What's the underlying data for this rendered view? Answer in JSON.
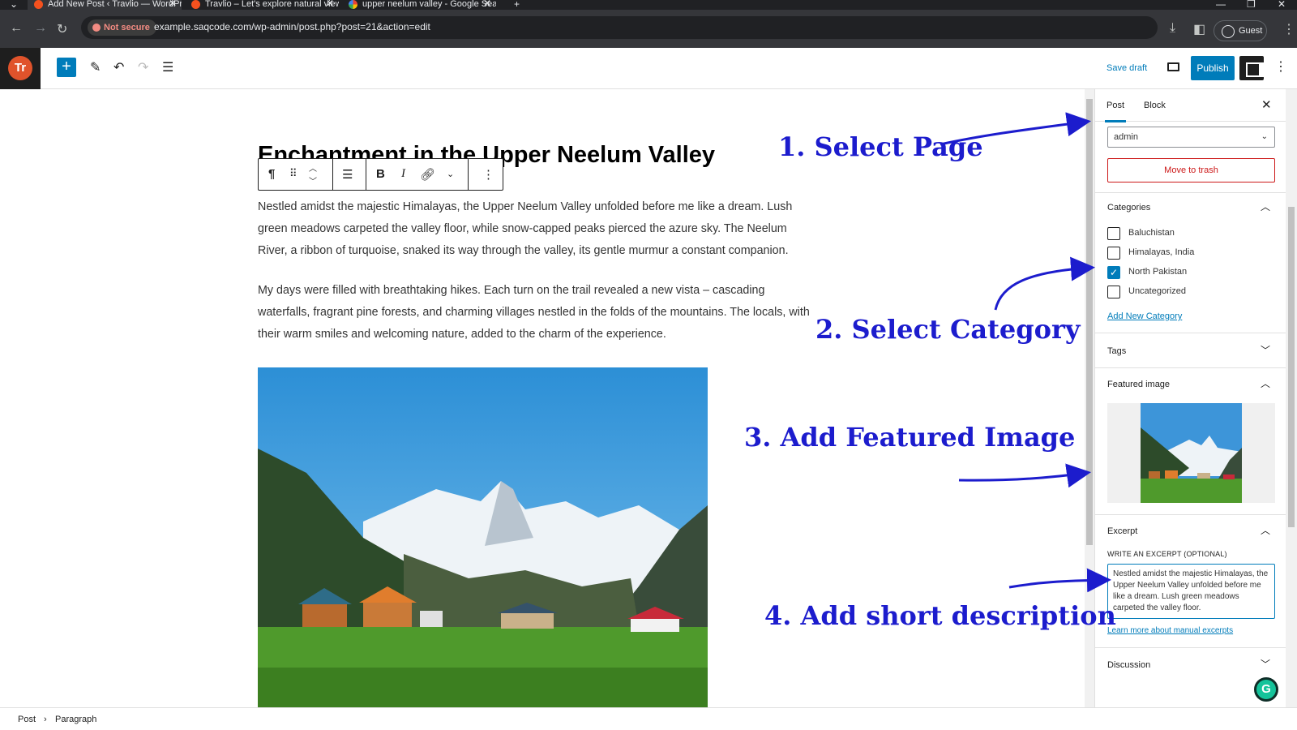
{
  "browser": {
    "tabs": [
      {
        "label": "Add New Post ‹ Travlio — WordPress"
      },
      {
        "label": "Travlio – Let's explore natural views"
      },
      {
        "label": "upper neelum valley - Google Search"
      }
    ],
    "not_secure_label": "Not secure",
    "url": "example.saqcode.com/wp-admin/post.php?post=21&action=edit",
    "guest_label": "Guest"
  },
  "wp_header": {
    "logo_text": "Tr",
    "save_draft_label": "Save draft",
    "publish_label": "Publish"
  },
  "post": {
    "title": "Enchantment in the Upper Neelum Valley",
    "paragraphs": [
      "Nestled amidst the majestic Himalayas, the Upper Neelum Valley unfolded before me like a dream. Lush green meadows carpeted the valley floor, while snow-capped peaks pierced the azure sky. The Neelum River, a ribbon of turquoise, snaked its way through the valley, its gentle murmur a constant companion.",
      "My days were filled with breathtaking hikes. Each turn on the trail revealed a new vista – cascading waterfalls, fragrant pine forests, and charming villages nestled in the folds of the mountains. The locals, with their warm smiles and welcoming nature, added to the charm of the experience."
    ]
  },
  "sidebar": {
    "tabs": [
      {
        "label": "Post"
      },
      {
        "label": "Block"
      }
    ],
    "author_value": "admin",
    "trash_label": "Move to trash",
    "categories_title": "Categories",
    "categories": [
      {
        "label": "Baluchistan",
        "checked": false
      },
      {
        "label": "Himalayas, India",
        "checked": false
      },
      {
        "label": "North Pakistan",
        "checked": true
      },
      {
        "label": "Uncategorized",
        "checked": false
      }
    ],
    "add_category_label": "Add New Category",
    "tags_title": "Tags",
    "featured_title": "Featured image",
    "excerpt_title": "Excerpt",
    "excerpt_label": "WRITE AN EXCERPT (OPTIONAL)",
    "excerpt_value": "Nestled amidst the majestic Himalayas, the Upper Neelum Valley unfolded before me like a dream. Lush green meadows carpeted the valley floor.",
    "excerpt_help_link": "Learn more about manual excerpts",
    "discussion_title": "Discussion"
  },
  "breadcrumb": {
    "items": [
      {
        "label": "Post"
      },
      {
        "label": "Paragraph"
      }
    ]
  },
  "annotations": [
    {
      "label": "1. Select Page"
    },
    {
      "label": "2. Select Category"
    },
    {
      "label": "3. Add Featured Image"
    },
    {
      "label": "4. Add short description"
    }
  ],
  "colors": {
    "accent": "#007cba",
    "annotation": "#1c1ccd",
    "danger": "#cc1818"
  }
}
